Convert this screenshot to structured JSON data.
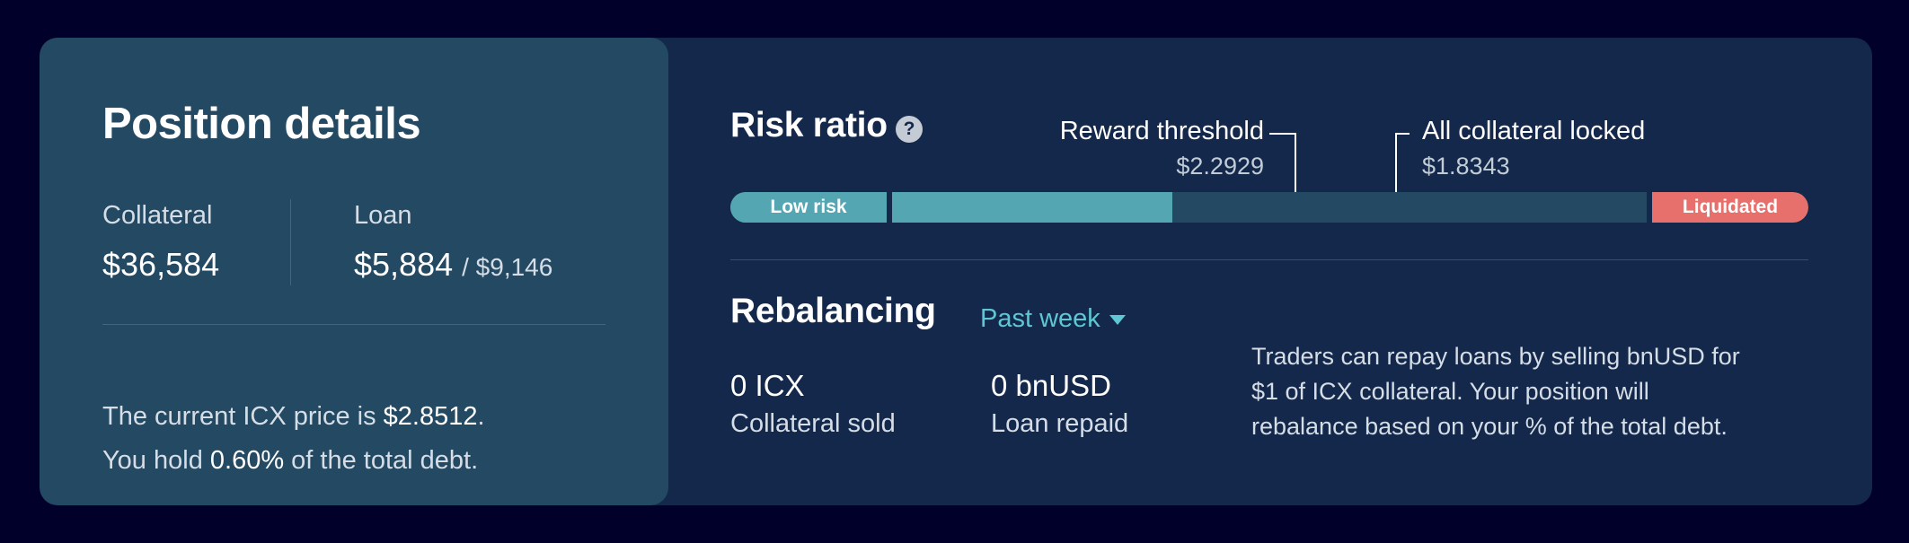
{
  "position": {
    "title": "Position details",
    "collateral": {
      "label": "Collateral",
      "value": "$36,584"
    },
    "loan": {
      "label": "Loan",
      "value": "$5,884",
      "limit": "/ $9,146"
    },
    "price_line": {
      "prefix": "The current ICX price is ",
      "value": "$2.8512",
      "suffix": "."
    },
    "debt_line": {
      "prefix": "You hold ",
      "value": "0.60%",
      "suffix": " of the total debt."
    }
  },
  "risk": {
    "title": "Risk ratio",
    "help_icon": "question-circle-icon",
    "reward_threshold": {
      "label": "Reward threshold",
      "value": "$2.2929"
    },
    "collateral_locked": {
      "label": "All collateral locked",
      "value": "$1.8343"
    },
    "low_label": "Low risk",
    "liquidated_label": "Liquidated",
    "current_level": 0.41,
    "colors": {
      "fill": "#54a6b2",
      "track": "#244963",
      "liquidated": "#e7706c"
    }
  },
  "rebalancing": {
    "title": "Rebalancing",
    "period": "Past week",
    "period_icon": "chevron-down-icon",
    "collateral_sold": {
      "value": "0 ICX",
      "label": "Collateral sold"
    },
    "loan_repaid": {
      "value": "0 bnUSD",
      "label": "Loan repaid"
    },
    "explanation": [
      "Traders can repay loans by selling bnUSD for",
      "$1 of ICX collateral. Your position will",
      "rebalance based on your % of the total debt."
    ]
  }
}
